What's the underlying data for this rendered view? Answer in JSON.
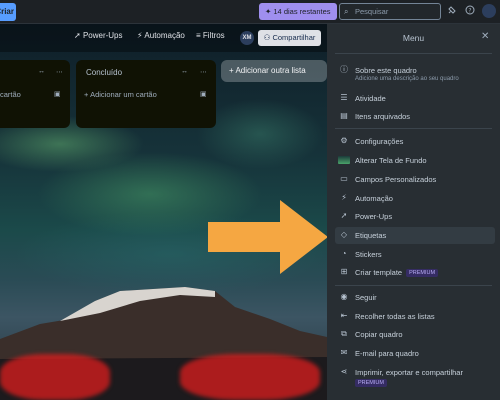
{
  "topbar": {
    "create_label": "Criar",
    "trial_label": "14 dias restantes",
    "search_placeholder": "Pesquisar"
  },
  "boardbar": {
    "powerups": "Power-Ups",
    "automation": "Automação",
    "filters": "Filtros",
    "avatar_initials": "XM",
    "share": "Compartilhar"
  },
  "lists": [
    {
      "title": "",
      "card": "cartão"
    },
    {
      "title": "Concluído",
      "add_card": "Adicionar um cartão"
    }
  ],
  "add_list": "Adicionar outra lista",
  "menu": {
    "title": "Menu",
    "items": [
      {
        "label": "Sobre este quadro",
        "sub": "Adicione uma descrição ao seu quadro",
        "icon": "info-icon"
      },
      {
        "label": "Atividade",
        "icon": "activity-icon"
      },
      {
        "label": "Itens arquivados",
        "icon": "archive-icon"
      },
      {
        "label": "Configurações",
        "icon": "gear-icon"
      },
      {
        "label": "Alterar Tela de Fundo",
        "icon": "background-thumbnail"
      },
      {
        "label": "Campos Personalizados",
        "icon": "custom-fields-icon"
      },
      {
        "label": "Automação",
        "icon": "automation-icon"
      },
      {
        "label": "Power-Ups",
        "icon": "rocket-icon"
      },
      {
        "label": "Etiquetas",
        "icon": "tag-icon"
      },
      {
        "label": "Stickers",
        "icon": "sticker-icon"
      },
      {
        "label": "Criar template",
        "badge": "PREMIUM",
        "icon": "template-icon"
      },
      {
        "label": "Seguir",
        "icon": "eye-icon"
      },
      {
        "label": "Recolher todas as listas",
        "icon": "collapse-icon"
      },
      {
        "label": "Copiar quadro",
        "icon": "copy-icon"
      },
      {
        "label": "E-mail para quadro",
        "icon": "email-icon"
      },
      {
        "label": "Imprimir, exportar e compartilhar",
        "badge": "PREMIUM",
        "icon": "share-icon"
      }
    ]
  },
  "colors": {
    "accent_arrow": "#f5a742",
    "trial_purple": "#9f8fef",
    "menu_bg": "#282e33"
  }
}
